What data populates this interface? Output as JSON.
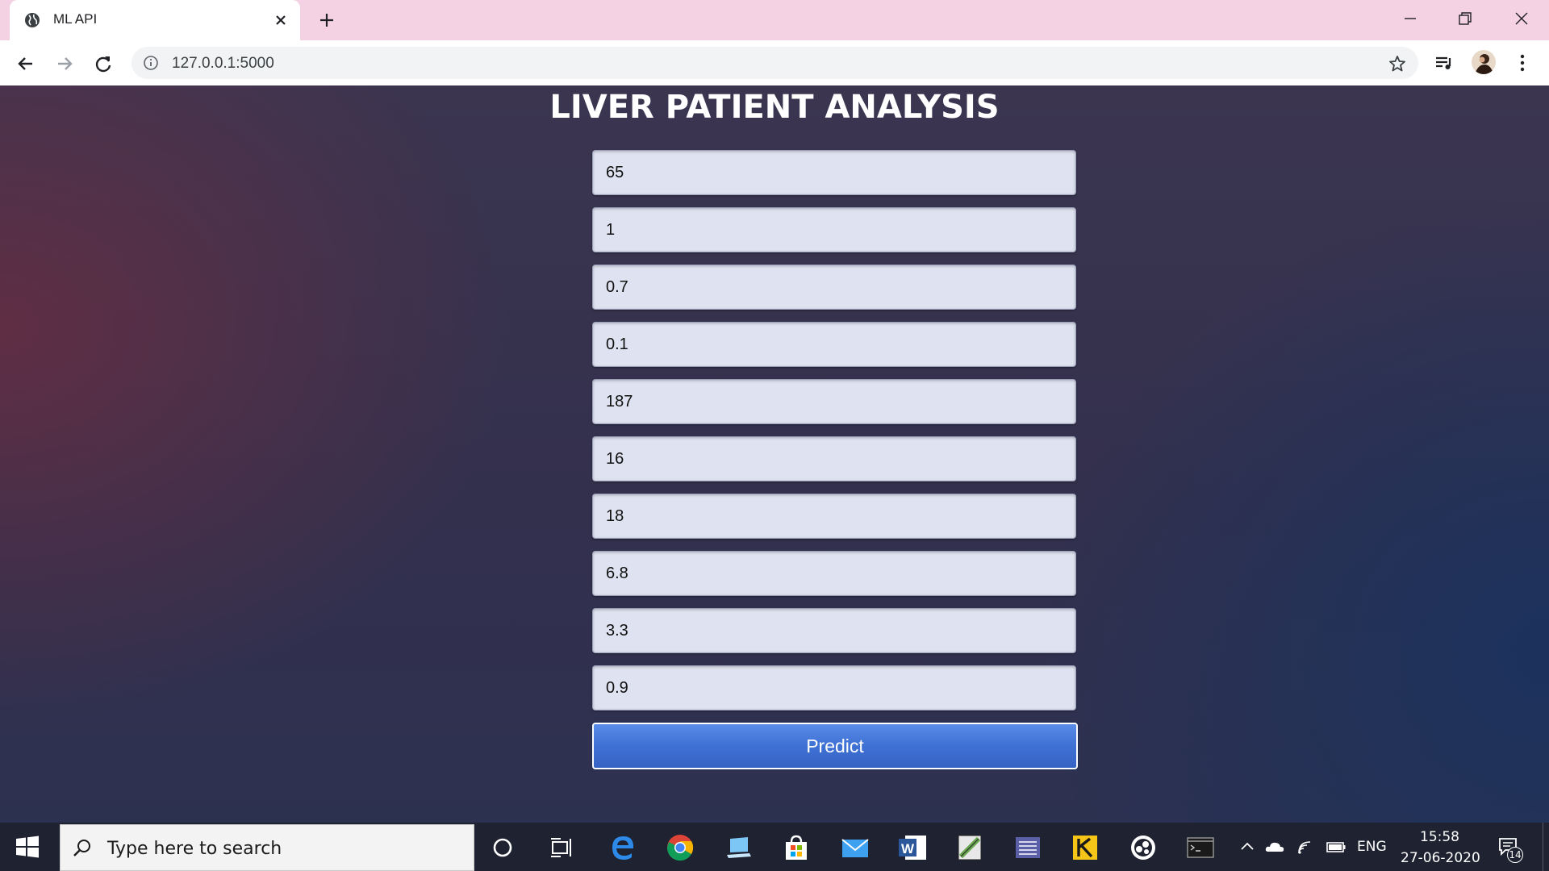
{
  "browser": {
    "tab_title": "ML API",
    "url": "127.0.0.1:5000"
  },
  "page": {
    "title": "LIVER PATIENT ANALYSIS",
    "fields": [
      "65",
      "1",
      "0.7",
      "0.1",
      "187",
      "16",
      "18",
      "6.8",
      "3.3",
      "0.9"
    ],
    "predict_label": "Predict"
  },
  "taskbar": {
    "search_placeholder": "Type here to search",
    "language": "ENG",
    "time": "15:58",
    "date": "27-06-2020",
    "notification_count": "14"
  },
  "colors": {
    "tabstrip": "#f4d2e3",
    "button_blue": "#3f71d4",
    "field_bg": "#dfe2f0"
  }
}
